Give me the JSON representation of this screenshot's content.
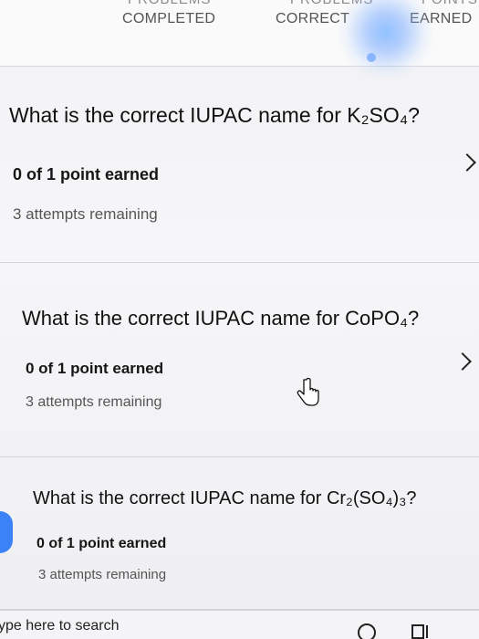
{
  "header": {
    "top_cut_left": "PROBLEMS",
    "top_cut_mid": "PROBLEMS",
    "top_cut_right": "POINTS",
    "col_completed": "COMPLETED",
    "col_correct": "CORRECT",
    "col_earned": "EARNED"
  },
  "questions": [
    {
      "text": "What is the correct IUPAC name for K₂SO₄?",
      "points": "0 of 1 point earned",
      "attempts": "3 attempts remaining"
    },
    {
      "text": "What is the correct IUPAC name for CoPO₄?",
      "points": "0 of 1 point earned",
      "attempts": "3 attempts remaining"
    },
    {
      "text": "What is the correct IUPAC name for Cr₂(SO₄)₃?",
      "points": "0 of 1 point earned",
      "attempts": "3 attempts remaining"
    }
  ],
  "taskbar": {
    "search_placeholder": "ype here to search"
  },
  "icons": {
    "chevron": "chevron-right-icon",
    "cursor": "hand-pointer-icon",
    "search": "cortana-circle-icon",
    "taskview": "task-view-icon"
  }
}
